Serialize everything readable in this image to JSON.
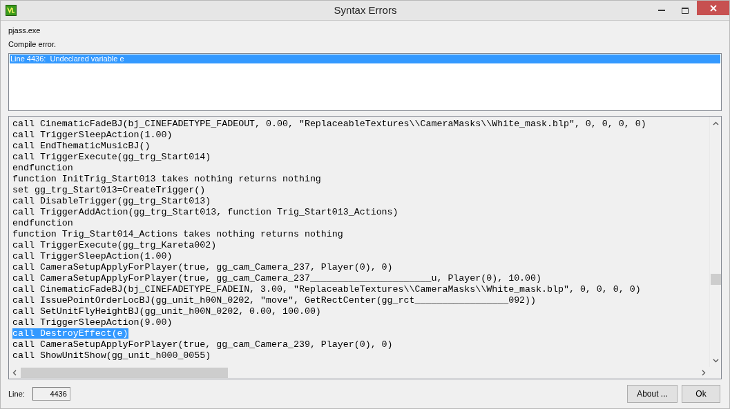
{
  "window": {
    "title": "Syntax Errors"
  },
  "program": "pjass.exe",
  "status": "Compile error.",
  "errors": [
    {
      "text": "Line 4436:  Undeclared variable e",
      "selected": true
    }
  ],
  "code_lines": [
    {
      "text": "call CinematicFadeBJ(bj_CINEFADETYPE_FADEOUT, 0.00, \"ReplaceableTextures\\\\CameraMasks\\\\White_mask.blp\", 0, 0, 0, 0)",
      "selected": false
    },
    {
      "text": "call TriggerSleepAction(1.00)",
      "selected": false
    },
    {
      "text": "call EndThematicMusicBJ()",
      "selected": false
    },
    {
      "text": "call TriggerExecute(gg_trg_Start014)",
      "selected": false
    },
    {
      "text": "endfunction",
      "selected": false
    },
    {
      "text": "function InitTrig_Start013 takes nothing returns nothing",
      "selected": false
    },
    {
      "text": "set gg_trg_Start013=CreateTrigger()",
      "selected": false
    },
    {
      "text": "call DisableTrigger(gg_trg_Start013)",
      "selected": false
    },
    {
      "text": "call TriggerAddAction(gg_trg_Start013, function Trig_Start013_Actions)",
      "selected": false
    },
    {
      "text": "endfunction",
      "selected": false
    },
    {
      "text": "function Trig_Start014_Actions takes nothing returns nothing",
      "selected": false
    },
    {
      "text": "call TriggerExecute(gg_trg_Kareta002)",
      "selected": false
    },
    {
      "text": "call TriggerSleepAction(1.00)",
      "selected": false
    },
    {
      "text": "call CameraSetupApplyForPlayer(true, gg_cam_Camera_237, Player(0), 0)",
      "selected": false
    },
    {
      "text": "call CameraSetupApplyForPlayer(true, gg_cam_Camera_237______________________u, Player(0), 10.00)",
      "selected": false
    },
    {
      "text": "call CinematicFadeBJ(bj_CINEFADETYPE_FADEIN, 3.00, \"ReplaceableTextures\\\\CameraMasks\\\\White_mask.blp\", 0, 0, 0, 0)",
      "selected": false
    },
    {
      "text": "call IssuePointOrderLocBJ(gg_unit_h00N_0202, \"move\", GetRectCenter(gg_rct_________________092))",
      "selected": false
    },
    {
      "text": "call SetUnitFlyHeightBJ(gg_unit_h00N_0202, 0.00, 100.00)",
      "selected": false
    },
    {
      "text": "call TriggerSleepAction(9.00)",
      "selected": false
    },
    {
      "text": "call DestroyEffect(e)",
      "selected": true
    },
    {
      "text": "call CameraSetupApplyForPlayer(true, gg_cam_Camera_239, Player(0), 0)",
      "selected": false
    },
    {
      "text": "call ShowUnitShow(gg_unit_h000_0055)",
      "selected": false
    }
  ],
  "line_field": {
    "label": "Line:",
    "value": "4436"
  },
  "buttons": [
    {
      "label": "About ..."
    },
    {
      "label": "Ok"
    }
  ]
}
